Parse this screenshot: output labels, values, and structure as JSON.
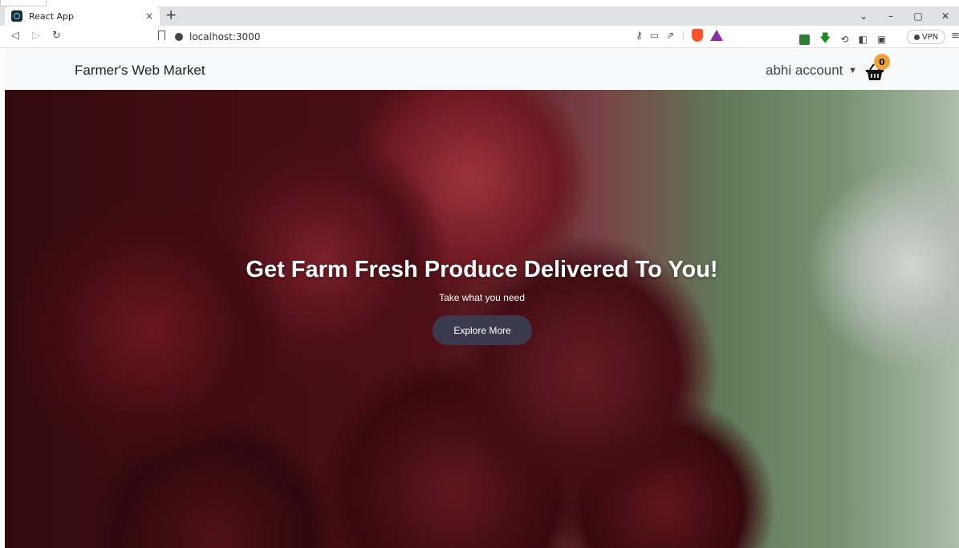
{
  "browser": {
    "tab_title": "React App",
    "tab_close": "×",
    "new_tab": "+",
    "url": "localhost:3000",
    "vpn_label": "VPN",
    "window_controls": [
      "⌄",
      "–",
      "▢",
      "✕"
    ]
  },
  "navbar": {
    "brand": "Farmer's Web Market",
    "account_label": "abhi account",
    "cart_count": "0"
  },
  "hero": {
    "title": "Get Farm Fresh Produce Delivered To You!",
    "subtitle": "Take what you need",
    "button_label": "Explore More"
  }
}
